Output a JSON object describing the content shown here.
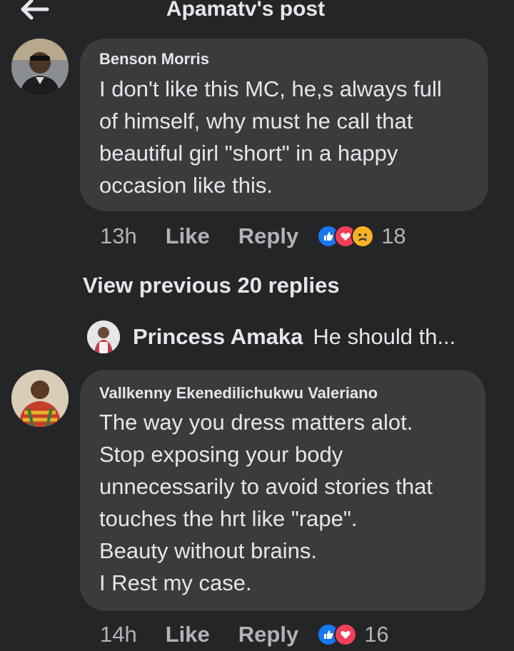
{
  "header": {
    "title": "Apamatv's post",
    "back_icon": "arrow-left-icon"
  },
  "comments": [
    {
      "author": "Benson Morris",
      "text": "I don't like this MC, he,s always full\nof himself,  why must he call that\nbeautiful girl \"short\" in a happy\noccasion like this.",
      "time": "13h",
      "like_label": "Like",
      "reply_label": "Reply",
      "reactions": [
        "like",
        "love",
        "sad"
      ],
      "reaction_count": "18"
    },
    {
      "author": "Vallkenny Ekenedilichukwu Valeriano",
      "text": "The way you dress matters alot.\nStop exposing your body\nunnecessarily to avoid stories that\ntouches the hrt like \"rape\".\nBeauty without brains.\nI Rest my case.",
      "time": "14h",
      "like_label": "Like",
      "reply_label": "Reply",
      "reactions": [
        "like",
        "love"
      ],
      "reaction_count": "16"
    }
  ],
  "view_previous": "View previous 20 replies",
  "reply_preview": {
    "author": "Princess Amaka",
    "snippet": "He should th..."
  },
  "colors": {
    "background": "#242526",
    "bubble": "#3a3b3c",
    "like": "#1877f2",
    "love": "#f33e58",
    "sad": "#f7b125",
    "muted_text": "#b0b3b8"
  }
}
